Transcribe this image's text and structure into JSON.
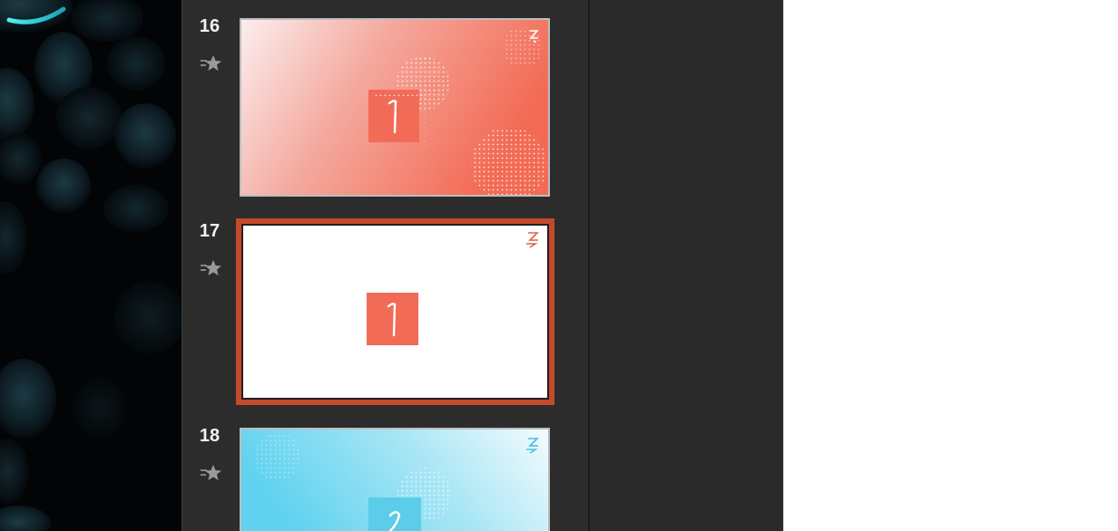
{
  "slides": [
    {
      "number": "16",
      "theme": "coral-gradient",
      "content_digit": "1",
      "selected": false,
      "has_transition": true,
      "accent_color": "#f26b57"
    },
    {
      "number": "17",
      "theme": "white",
      "content_digit": "1",
      "selected": true,
      "has_transition": true,
      "accent_color": "#f26b57"
    },
    {
      "number": "18",
      "theme": "cyan-gradient",
      "content_digit": "2",
      "selected": false,
      "has_transition": true,
      "accent_color": "#5bcdea"
    }
  ],
  "icons": {
    "transition": "star-transition-icon",
    "corner_logo": "slides-logo-icon"
  },
  "colors": {
    "selection_border": "#c44a2c",
    "navigator_bg": "#2c2c2c",
    "coral": "#f26b57",
    "cyan": "#5bcdea"
  }
}
